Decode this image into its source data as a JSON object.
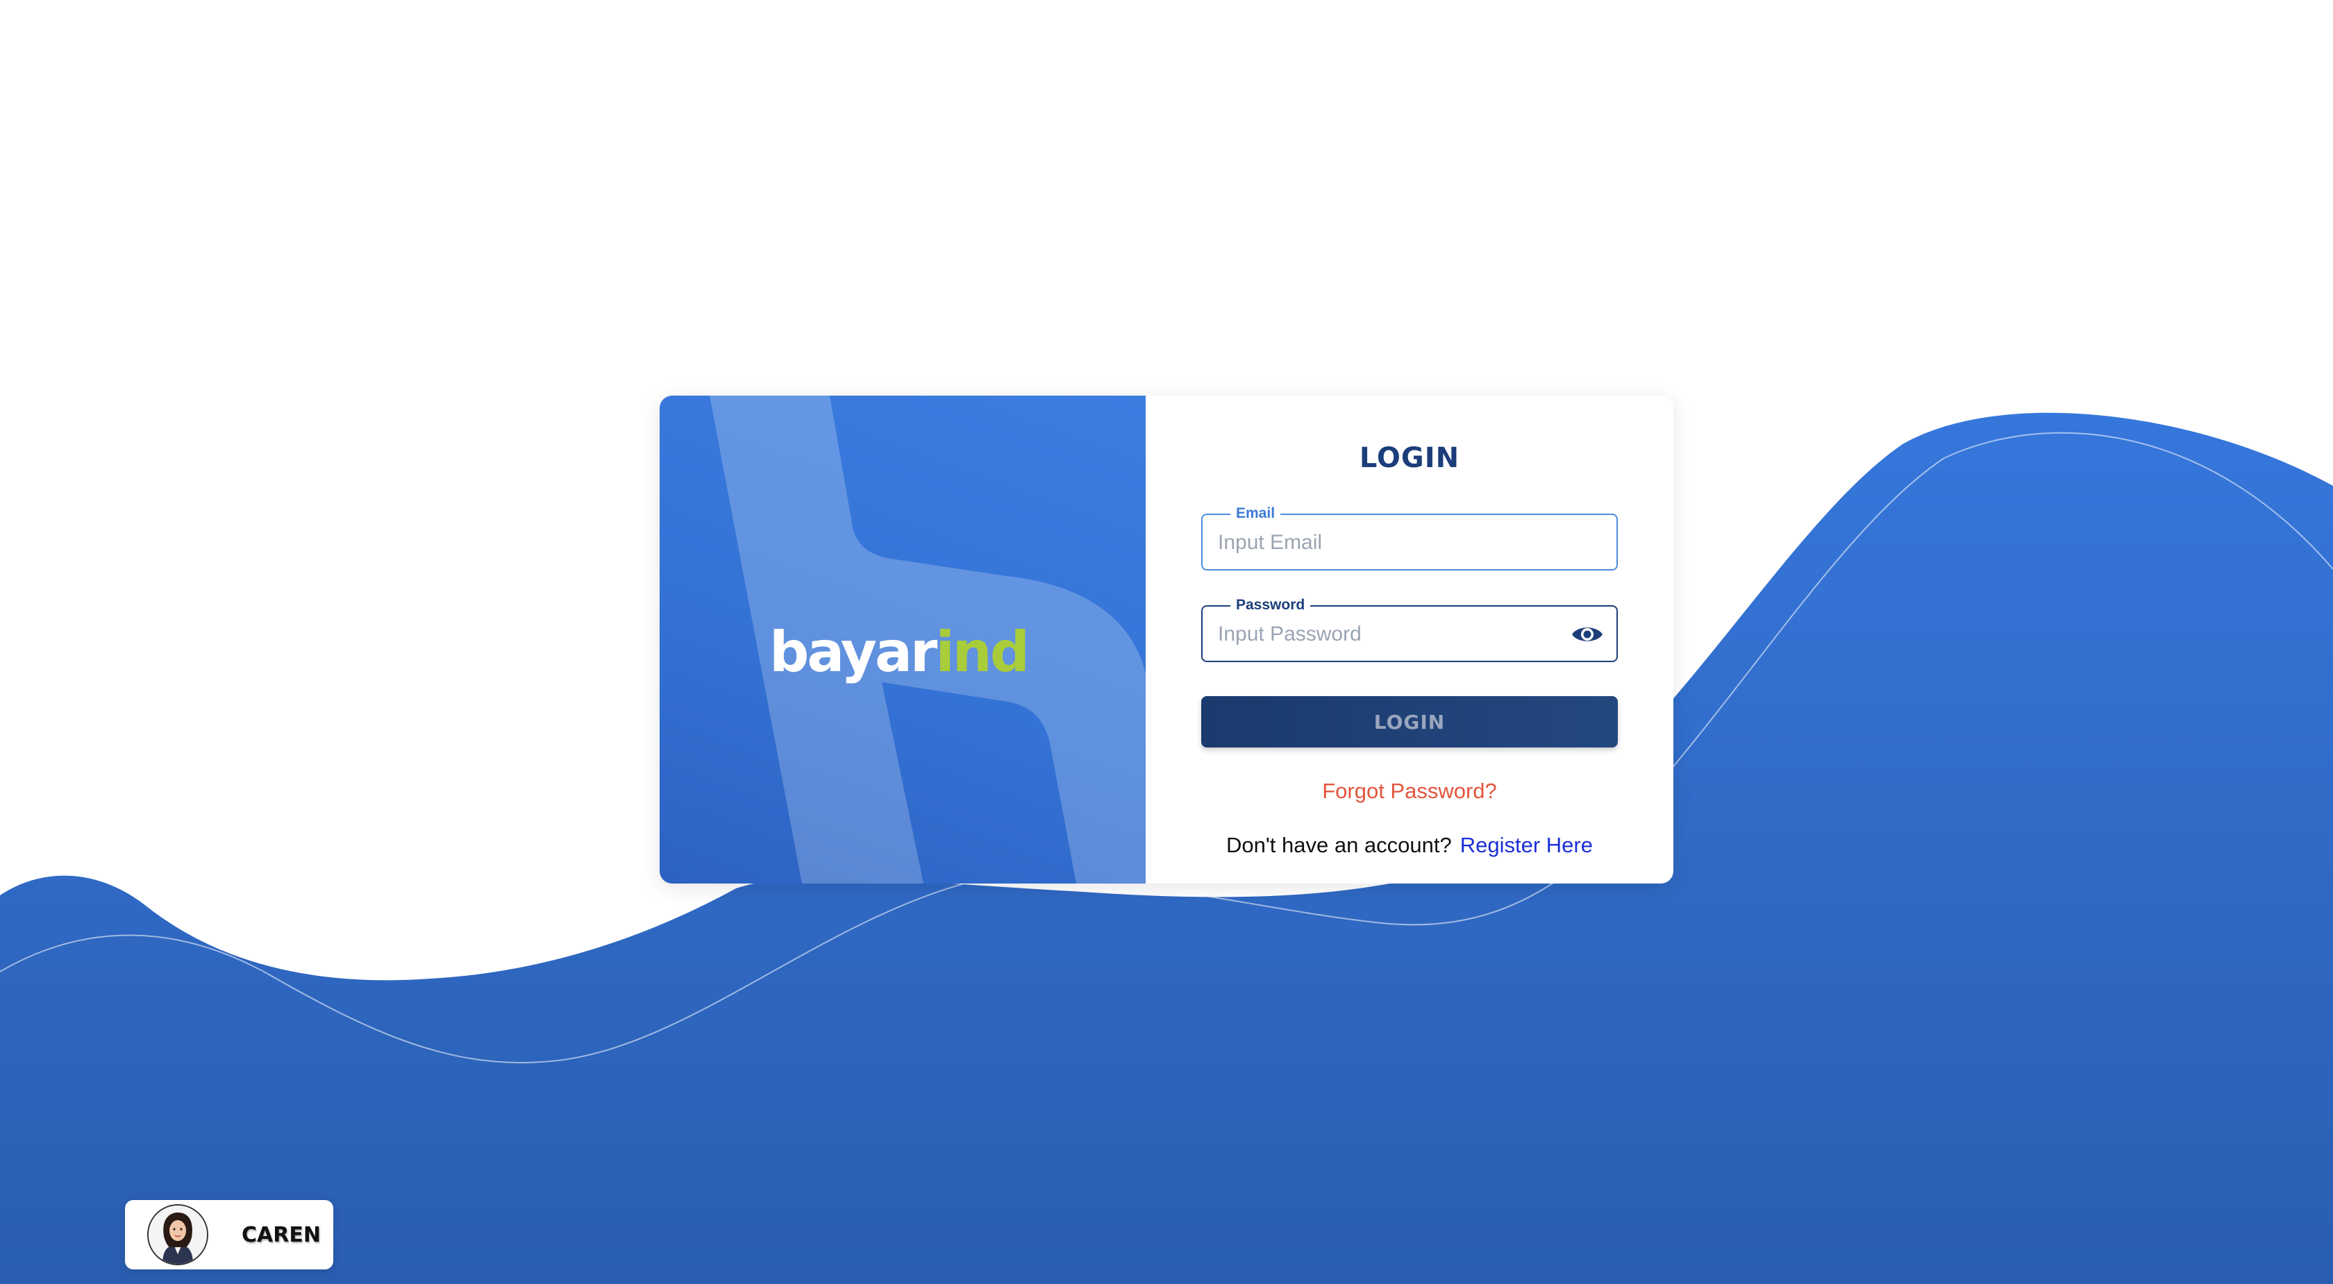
{
  "brand": {
    "logo_part1": "bayar",
    "logo_part2": "ind"
  },
  "login_form": {
    "title": "LOGIN",
    "email_label": "Email",
    "email_placeholder": "Input Email",
    "email_value": "",
    "password_label": "Password",
    "password_placeholder": "Input Password",
    "password_value": "",
    "password_toggle_icon": "eye-icon",
    "submit_label": "LOGIN",
    "forgot_password": "Forgot Password?",
    "no_account_text": "Don't have an account?",
    "register_link": "Register Here"
  },
  "user_chip": {
    "name": "CAREN",
    "avatar_icon": "avatar-icon"
  },
  "colors": {
    "primary_blue": "#3473d6",
    "navy": "#1b3e7a",
    "logo_green": "#a9cc3a",
    "forgot_red": "#e3553c",
    "register_link_blue": "#1a2fd6"
  }
}
